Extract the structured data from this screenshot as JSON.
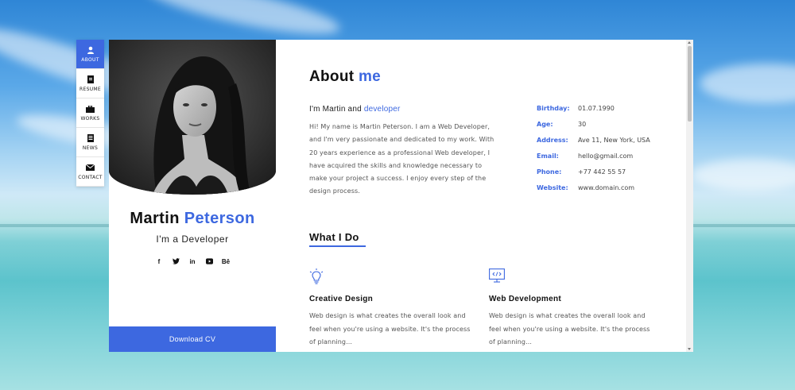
{
  "sidenav": {
    "items": [
      {
        "label": "ABOUT",
        "icon": "user-icon",
        "active": true
      },
      {
        "label": "RESUME",
        "icon": "document-icon",
        "active": false
      },
      {
        "label": "WORKS",
        "icon": "briefcase-icon",
        "active": false
      },
      {
        "label": "NEWS",
        "icon": "newspaper-icon",
        "active": false
      },
      {
        "label": "CONTACT",
        "icon": "envelope-icon",
        "active": false
      }
    ]
  },
  "profile": {
    "first_name": "Martin",
    "last_name": "Peterson",
    "role": "I'm a Developer",
    "socials": [
      {
        "name": "facebook-icon",
        "glyph": "f"
      },
      {
        "name": "twitter-icon",
        "glyph": "t"
      },
      {
        "name": "linkedin-icon",
        "glyph": "in"
      },
      {
        "name": "youtube-icon",
        "glyph": "▶"
      },
      {
        "name": "behance-icon",
        "glyph": "Bē"
      }
    ],
    "download_label": "Download CV"
  },
  "about": {
    "title_main": "About",
    "title_accent": "me",
    "intro_prefix": "I'm Martin and",
    "intro_accent": "developer",
    "intro_text": "Hi! My name is Martin Peterson. I am a Web Developer, and I'm very passionate and dedicated to my work. With 20 years experience as a professional Web developer, I have acquired the skills and knowledge necessary to make your project a success. I enjoy every step of the design process.",
    "info": [
      {
        "key": "Birthday:",
        "value": "01.07.1990"
      },
      {
        "key": "Age:",
        "value": "30"
      },
      {
        "key": "Address:",
        "value": "Ave 11, New York, USA"
      },
      {
        "key": "Email:",
        "value": "hello@gmail.com"
      },
      {
        "key": "Phone:",
        "value": "+77 442 55 57"
      },
      {
        "key": "Website:",
        "value": "www.domain.com"
      }
    ]
  },
  "services": {
    "title": "What I Do",
    "items": [
      {
        "title": "Creative Design",
        "icon": "lightbulb-icon",
        "text": "Web design is what creates the overall look and feel when you're using a website. It's the process of planning..."
      },
      {
        "title": "Web Development",
        "icon": "code-monitor-icon",
        "text": "Web design is what creates the overall look and feel when you're using a website. It's the process of planning..."
      }
    ]
  },
  "colors": {
    "accent": "#3d68e0"
  }
}
